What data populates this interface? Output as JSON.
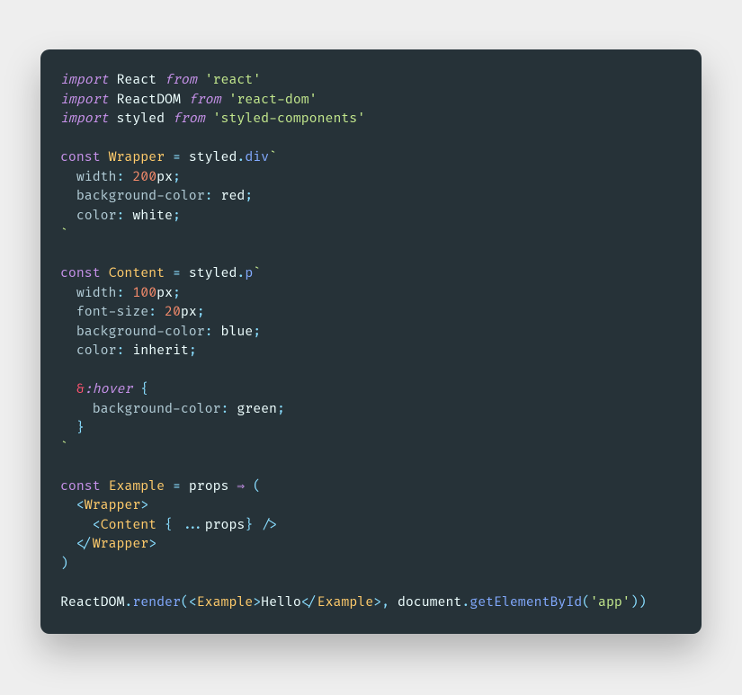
{
  "colors": {
    "background_page": "#eeeeee",
    "background_card": "#263238",
    "keyword": "#c792ea",
    "function": "#82aaff",
    "classname": "#ffcb6b",
    "string": "#c3e88d",
    "number": "#f78c6c",
    "operator": "#89ddff",
    "attr": "#b2ccd6",
    "tag": "#f07178",
    "amp": "#ff5370",
    "text": "#eeffff"
  },
  "code": {
    "language": "javascript",
    "lines": [
      "import React from 'react'",
      "import ReactDOM from 'react-dom'",
      "import styled from 'styled-components'",
      "",
      "const Wrapper = styled.div`",
      "  width: 200px;",
      "  background-color: red;",
      "  color: white;",
      "`",
      "",
      "const Content = styled.p`",
      "  width: 100px;",
      "  font-size: 20px;",
      "  background-color: blue;",
      "  color: inherit;",
      "",
      "  &:hover {",
      "    background-color: green;",
      "  }",
      "`",
      "",
      "const Example = props ⇒ (",
      "  <Wrapper>",
      "    <Content { ...props} />",
      "  </Wrapper>",
      ")",
      "",
      "ReactDOM.render(<Example>Hello</Example>, document.getElementById('app'))"
    ]
  },
  "tokens": {
    "import": "import",
    "from": "from",
    "const": "const",
    "React": "React",
    "ReactDOM": "ReactDOM",
    "styled": "styled",
    "str_react": "'react'",
    "str_react_dom": "'react-dom'",
    "str_styled_components": "'styled-components'",
    "Wrapper": "Wrapper",
    "Content": "Content",
    "Example": "Example",
    "styled_div": "styled",
    "dot": ".",
    "div": "div",
    "p": "p",
    "backtick": "`",
    "css_width": "width",
    "css_bg": "background-color",
    "css_color": "color",
    "css_fs": "font-size",
    "colon": ":",
    "semi": ";",
    "px200": "200",
    "px100": "100",
    "px20": "20",
    "px": "px",
    "red": "red",
    "white": "white",
    "blue": "blue",
    "inherit": "inherit",
    "green": "green",
    "amp": "&",
    "hover": ":hover",
    "lbrace": "{",
    "rbrace": "}",
    "eq": "=",
    "props": "props",
    "arrow": "⇒",
    "lparen": "(",
    "rparen": ")",
    "lt": "<",
    "gt": ">",
    "slash": "/",
    "spread": "...",
    "sp": " ",
    "render": "render",
    "Hello": "Hello",
    "document": "document",
    "getElementById": "getElementById",
    "str_app": "'app'",
    "comma": ","
  }
}
